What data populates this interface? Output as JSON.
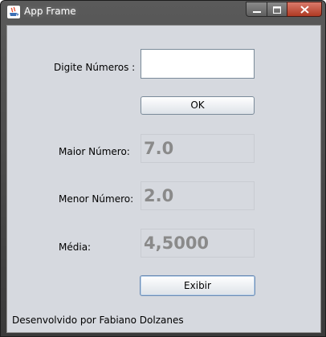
{
  "window": {
    "title": "App Frame"
  },
  "form": {
    "input_label": "Digite Números :",
    "input_value": "",
    "ok_label": "OK",
    "max_label": "Maior Número:",
    "max_value": "7.0",
    "min_label": "Menor Número:",
    "min_value": "2.0",
    "avg_label": "Média:",
    "avg_value": "4,5000",
    "exibir_label": "Exibir"
  },
  "footer": {
    "credit": "Desenvolvido por Fabiano Dolzanes"
  },
  "icons": {
    "app": "java-cup-icon",
    "minimize": "minimize-icon",
    "maximize": "maximize-icon",
    "close": "close-icon"
  }
}
